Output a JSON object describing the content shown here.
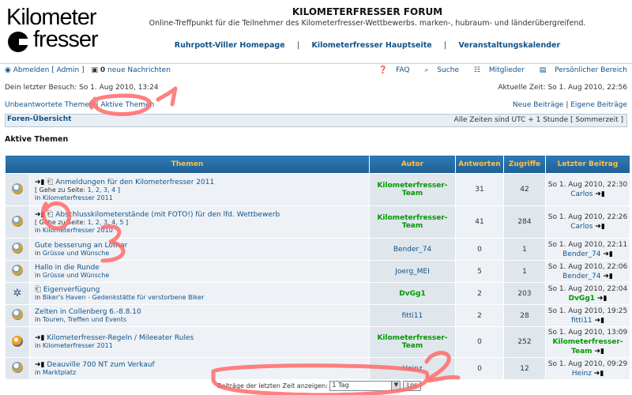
{
  "header": {
    "logo_line1": "Kilometer",
    "logo_line2": "fresser",
    "title": "KILOMETERFRESSER FORUM",
    "description": "Online-Treffpunkt für die Teilnehmer des Kilometerfresser-Wettbewerbs. marken-, hubraum- und länderübergreifend.",
    "links": [
      "Ruhrpott-Viller Homepage",
      "Kilometerfresser Hauptseite",
      "Veranstaltungskalender"
    ]
  },
  "user_bar": {
    "logout": "Abmelden [ Admin ]",
    "messages_count": "0",
    "messages_text": "neue Nachrichten",
    "faq": "FAQ",
    "search": "Suche",
    "members": "Mitglieder",
    "personal": "Persönlicher Bereich"
  },
  "visit": {
    "last_visit": "Dein letzter Besuch: So 1. Aug 2010, 13:24",
    "current_time": "Aktuelle Zeit: So 1. Aug 2010, 22:56"
  },
  "subnav": {
    "unanswered": "Unbeantwortete Themen",
    "separator": "|",
    "active": "Aktive Themen",
    "new_posts": "Neue Beiträge",
    "own_posts": "Eigene Beiträge"
  },
  "navbar": {
    "forum_index": "Foren-Übersicht",
    "timezone": "Alle Zeiten sind UTC + 1 Stunde [ Sommerzeit ]"
  },
  "section_title": "Aktive Themen",
  "table": {
    "headers": {
      "topics": "Themen",
      "author": "Autor",
      "replies": "Antworten",
      "views": "Zugriffe",
      "last_post": "Letzter Beitrag"
    },
    "goto_prefix": "[ Gehe zu Seite:",
    "in_prefix": "in",
    "rows": [
      {
        "title": "Anmeldungen für den Kilometerfresser 2011",
        "pages": "1, 2, 3, 4",
        "forum": "Kilometerfresser 2011",
        "author": "Kilometerfresser-Team",
        "replies": "31",
        "views": "42",
        "last_date": "So 1. Aug 2010, 22:30",
        "last_user": "Carlos"
      },
      {
        "title": "Abschlusskilometerstände (mit FOTO!) für den lfd. Wettbewerb",
        "pages": "1, 2, 3, 4, 5",
        "forum": "Kilometerfresser 2010",
        "author": "Kilometerfresser-Team",
        "replies": "41",
        "views": "284",
        "last_date": "So 1. Aug 2010, 22:26",
        "last_user": "Carlos"
      },
      {
        "title": "Gute besserung an Lothar",
        "pages": "",
        "forum": "Grüsse und Wünsche",
        "author": "Bender_74",
        "replies": "0",
        "views": "1",
        "last_date": "So 1. Aug 2010, 22:11",
        "last_user": "Bender_74"
      },
      {
        "title": "Hallo in die Runde",
        "pages": "",
        "forum": "Grüsse und Wünsche",
        "author": "Joerg_MEI",
        "replies": "5",
        "views": "1",
        "last_date": "So 1. Aug 2010, 22:06",
        "last_user": "Bender_74"
      },
      {
        "title": "Eigenverfügung",
        "pages": "",
        "forum": "Biker's Haven - Gedenkstätte für verstorbene Biker",
        "author": "DvGg1",
        "replies": "2",
        "views": "203",
        "last_date": "So 1. Aug 2010, 22:04",
        "last_user": "DvGg1"
      },
      {
        "title": "Zelten in Collenberg 6.-8.8.10",
        "pages": "",
        "forum": "Touren, Treffen und Events",
        "author": "fitti11",
        "replies": "2",
        "views": "28",
        "last_date": "So 1. Aug 2010, 19:25",
        "last_user": "fitti11"
      },
      {
        "title": "Kilometerfresser-Regeln / Mileeater Rules",
        "pages": "",
        "forum": "Kilometerfresser 2011",
        "author": "Kilometerfresser-Team",
        "replies": "0",
        "views": "252",
        "last_date": "So 1. Aug 2010, 13:09",
        "last_user": "Kilometerfresser-Team"
      },
      {
        "title": "Deauville 700 NT zum Verkauf",
        "pages": "",
        "forum": "Marktplatz",
        "author": "Heinz",
        "replies": "0",
        "views": "12",
        "last_date": "So 1. Aug 2010, 09:29",
        "last_user": "Heinz"
      }
    ]
  },
  "footer": {
    "label": "Beiträge der letzten Zeit anzeigen:",
    "selected": "1 Tag",
    "button": "Los"
  },
  "colors": {
    "annotation": "#ff6b6b",
    "header_bg": "#1f5f93",
    "header_text": "#ffc04d",
    "green": "#009900"
  }
}
